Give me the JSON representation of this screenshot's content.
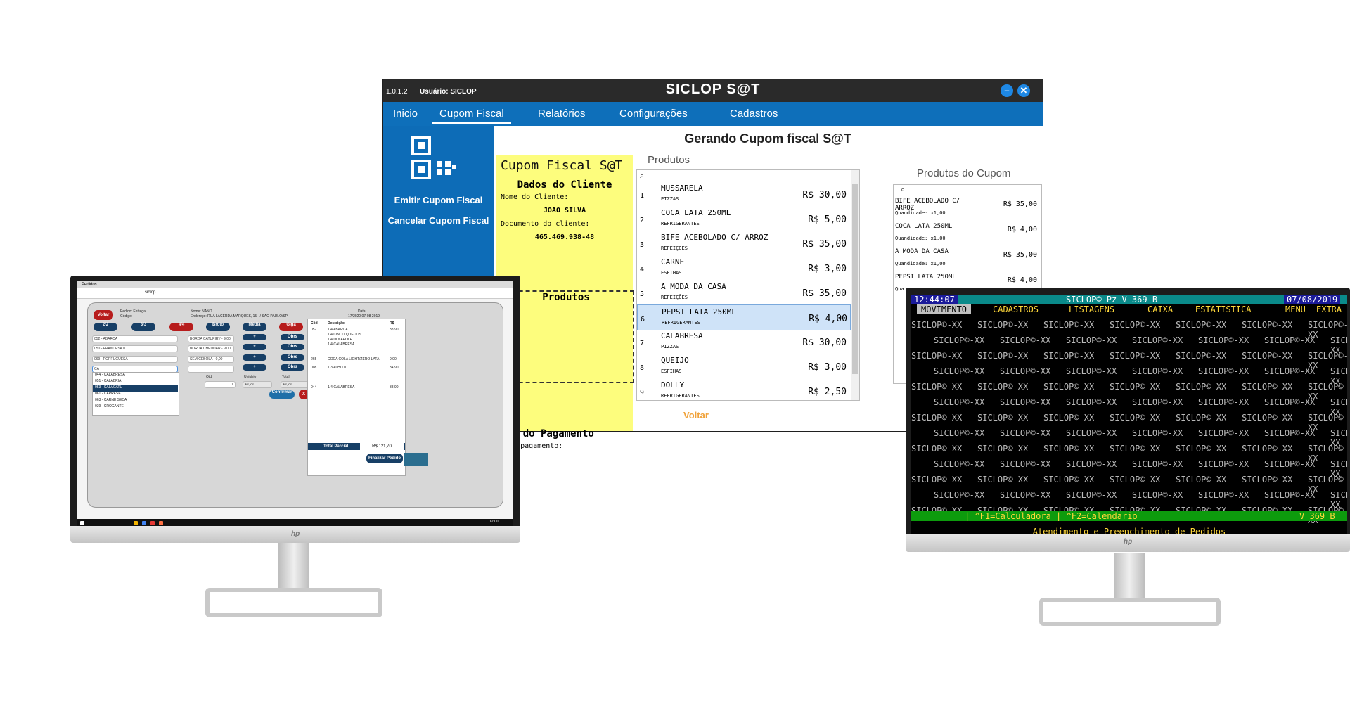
{
  "sat": {
    "version": "1.0.1.2",
    "user": "Usuário: SICLOP",
    "title": "SICLOP S@T",
    "minimize_icon": "minimize-icon",
    "close_icon": "close-icon",
    "menu": [
      "Inicio",
      "Cupom Fiscal",
      "Relatórios",
      "Configurações",
      "Cadastros"
    ],
    "active_menu": "Cupom Fiscal",
    "side_actions": [
      "Emitir Cupom Fiscal",
      "Cancelar Cupom Fiscal"
    ],
    "heading": "Gerando Cupom fiscal S@T",
    "cupom": {
      "title": "Cupom Fiscal S@T",
      "dados_title": "Dados do Cliente",
      "nome_label": "Nome do Cliente:",
      "nome_value": "JOAO SILVA",
      "doc_label": "Documento do cliente:",
      "doc_value": "465.469.938-48",
      "produtos_title": "Produtos",
      "pagamento_title": "dos do Pagamento",
      "pagamento_label": "a de pagamento:"
    },
    "produtos_header": "Produtos",
    "produtos": [
      {
        "n": "1",
        "name": "MUSSARELA",
        "cat": "PIZZAS",
        "price": "R$ 30,00"
      },
      {
        "n": "2",
        "name": "COCA LATA 250ML",
        "cat": "REFRIGERANTES",
        "price": "R$ 5,00"
      },
      {
        "n": "3",
        "name": "BIFE ACEBOLADO C/ ARROZ",
        "cat": "REFEIÇÕES",
        "price": "R$ 35,00"
      },
      {
        "n": "4",
        "name": "CARNE",
        "cat": "ESFIHAS",
        "price": "R$ 3,00"
      },
      {
        "n": "5",
        "name": "A MODA DA CASA",
        "cat": "REFEIÇÕES",
        "price": "R$ 35,00"
      },
      {
        "n": "6",
        "name": "PEPSI LATA 250ML",
        "cat": "REFRIGERANTES",
        "price": "R$ 4,00"
      },
      {
        "n": "7",
        "name": "CALABRESA",
        "cat": "PIZZAS",
        "price": "R$ 30,00"
      },
      {
        "n": "8",
        "name": "QUEIJO",
        "cat": "ESFIHAS",
        "price": "R$ 3,00"
      },
      {
        "n": "9",
        "name": "DOLLY",
        "cat": "REFRIGERANTES",
        "price": "R$ 2,50"
      }
    ],
    "selected_index": 5,
    "voltar": "Voltar",
    "cupom_header": "Produtos do Cupom",
    "cupom_itens": [
      {
        "name": "BIFE ACEBOLADO C/ ARROZ",
        "qty": "Quandidade: x1,00",
        "price": "R$ 35,00"
      },
      {
        "name": "COCA LATA 250ML",
        "qty": "Quandidade: x1,00",
        "price": "R$ 4,00"
      },
      {
        "name": "A MODA DA CASA",
        "qty": "Quandidade: x1,00",
        "price": "R$ 35,00"
      },
      {
        "name": "PEPSI LATA 250ML",
        "qty": "Qua",
        "price": "R$ 4,00"
      }
    ]
  },
  "pdv": {
    "tab": "Pedidos",
    "address": "siclop",
    "voltar": "Voltar",
    "pedido": "Pedido: Entrega",
    "codigo": "Código:",
    "nome": "Nome: NANO",
    "endereco": "Endereço: RUA LACERDA MARQUES, 15 - / SÃO PAULO/SP",
    "data": "Data:",
    "data_val": "17/2020 07-08-2019",
    "sizes": [
      "2/2",
      "3/3",
      "4/4",
      "Broto",
      "Média",
      "Giga"
    ],
    "flavors": [
      "052 - ABARCA",
      "050 - FRANCESA II",
      "069 - PORTUGUESA",
      "CA"
    ],
    "bordas": [
      "BORDA CATUPIRY - 9,00",
      "BORDA CHEDDAR - 9,00",
      "SEM CEBOLA - 0,00"
    ],
    "obs": "Obrs",
    "dropdown": [
      "044 - CALABRESA",
      "051 - CALABRIA",
      "053 - CALACATU",
      "061 - CAPRESE",
      "063 - CARNE SECA",
      "039 - CROCANTE"
    ],
    "qtd": "Qtd",
    "qtd_val": "1",
    "unitario": "Unitário",
    "unit_val": "49,29",
    "total": "Total",
    "total_val": "49,29",
    "confirmar": "Confirmar",
    "cancelar": "X",
    "col_cod": "Cód",
    "col_desc": "Descrição",
    "col_rs": "R$",
    "items": [
      {
        "cod": "052",
        "desc": "1/4 ABARCA",
        "val": "38,90"
      },
      {
        "cod": "",
        "desc": "1/4 CINCO QUEIJOS",
        "val": ""
      },
      {
        "cod": "",
        "desc": "1/4 DI NAPOLE",
        "val": ""
      },
      {
        "cod": "",
        "desc": "1/4 CALABRESA",
        "val": ""
      },
      {
        "cod": "265",
        "desc": "COCA COLA LIGHT/ZERO LATA",
        "val": "9,00"
      },
      {
        "cod": "008",
        "desc": "1/3 ALHO II",
        "val": "34,90"
      },
      {
        "cod": "044",
        "desc": "1/4 CALABRESA",
        "val": "38,90"
      }
    ],
    "total_parcial": "Total Parcial",
    "total_parcial_val": "R$ 121,70",
    "finalizar": "Finalizar Pedido",
    "clock": "12:00",
    "date": "07/08/2019"
  },
  "terminal": {
    "time": "12:44:07",
    "title": "SICLOP©-Pz V 369 B -",
    "date": "07/08/2019",
    "menu": [
      "MOVIMENTO",
      "CADASTROS",
      "LISTAGENS",
      "CAIXA",
      "ESTATISTICA",
      "MENU",
      "EXTRA"
    ],
    "watermark": "SICLOP©-XX",
    "fkeys": "| ^F1=Calculadora | ^F2=Calendario |",
    "version": "V 369 B",
    "status": "Atendimento e Preenchimento de Pedidos"
  },
  "colors": {
    "sat_blue": "#0e6fba",
    "yellow": "#fdfd7d",
    "terminal_teal": "#0a8a8a",
    "terminal_yellow": "#ffd83a",
    "pdv_red": "#b71c1c",
    "pdv_navy": "#173f66"
  }
}
